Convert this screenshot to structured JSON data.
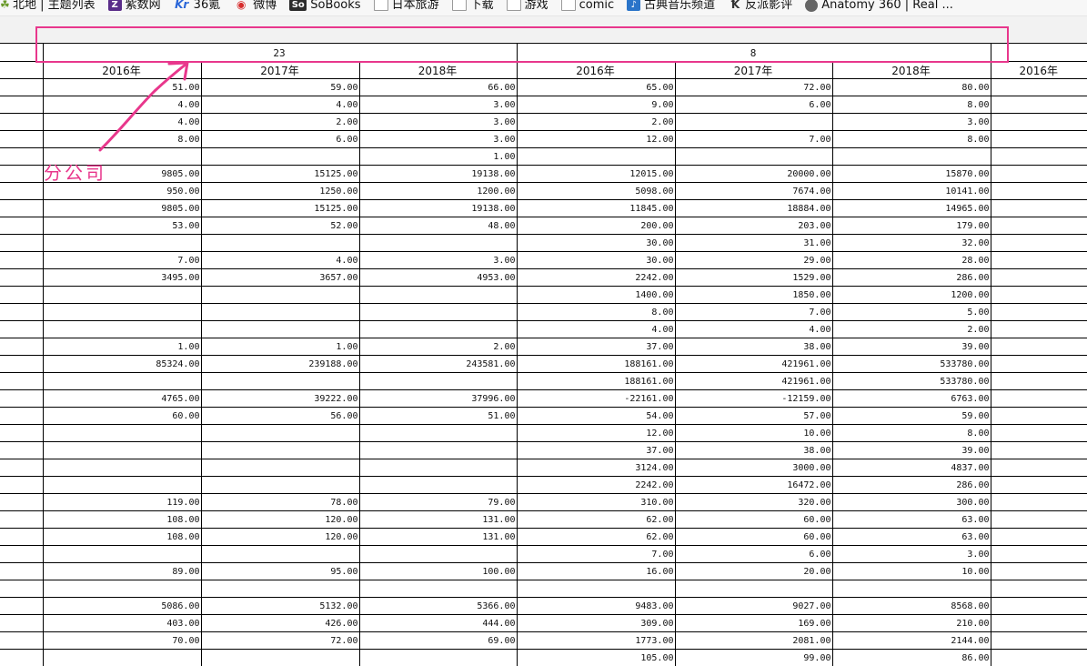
{
  "bookmarks": [
    {
      "label": "北地 | 主题列表",
      "icon": "leaf-icon"
    },
    {
      "label": "紫数网",
      "icon": "z-logo-icon"
    },
    {
      "label": "36氪",
      "icon": "kr-logo-icon"
    },
    {
      "label": "微博",
      "icon": "weibo-icon"
    },
    {
      "label": "SoBooks",
      "icon": "sobooks-icon"
    },
    {
      "label": "日本旅游",
      "icon": "folder-icon"
    },
    {
      "label": "下载",
      "icon": "folder-icon"
    },
    {
      "label": "游戏",
      "icon": "folder-icon"
    },
    {
      "label": "comic",
      "icon": "folder-icon"
    },
    {
      "label": "古典音乐频道",
      "icon": "music-icon"
    },
    {
      "label": "反派影评",
      "icon": "fan-icon"
    },
    {
      "label": "Anatomy 360 | Real ...",
      "icon": "globe-icon"
    }
  ],
  "table": {
    "groups": [
      "23",
      "8"
    ],
    "years": [
      "2016年",
      "2017年",
      "2018年",
      "2016年",
      "2017年",
      "2018年",
      "2016年"
    ],
    "rows": [
      [
        "51.00",
        "59.00",
        "66.00",
        "65.00",
        "72.00",
        "80.00"
      ],
      [
        "4.00",
        "4.00",
        "3.00",
        "9.00",
        "6.00",
        "8.00"
      ],
      [
        "4.00",
        "2.00",
        "3.00",
        "2.00",
        "",
        "3.00"
      ],
      [
        "8.00",
        "6.00",
        "3.00",
        "12.00",
        "7.00",
        "8.00"
      ],
      [
        "",
        "",
        "1.00",
        "",
        "",
        ""
      ],
      [
        "9805.00",
        "15125.00",
        "19138.00",
        "12015.00",
        "20000.00",
        "15870.00"
      ],
      [
        "950.00",
        "1250.00",
        "1200.00",
        "5098.00",
        "7674.00",
        "10141.00"
      ],
      [
        "9805.00",
        "15125.00",
        "19138.00",
        "11845.00",
        "18884.00",
        "14965.00"
      ],
      [
        "53.00",
        "52.00",
        "48.00",
        "200.00",
        "203.00",
        "179.00"
      ],
      [
        "",
        "",
        "",
        "30.00",
        "31.00",
        "32.00"
      ],
      [
        "7.00",
        "4.00",
        "3.00",
        "30.00",
        "29.00",
        "28.00"
      ],
      [
        "3495.00",
        "3657.00",
        "4953.00",
        "2242.00",
        "1529.00",
        "286.00"
      ],
      [
        "",
        "",
        "",
        "1400.00",
        "1850.00",
        "1200.00"
      ],
      [
        "",
        "",
        "",
        "8.00",
        "7.00",
        "5.00"
      ],
      [
        "",
        "",
        "",
        "4.00",
        "4.00",
        "2.00"
      ],
      [
        "1.00",
        "1.00",
        "2.00",
        "37.00",
        "38.00",
        "39.00"
      ],
      [
        "85324.00",
        "239188.00",
        "243581.00",
        "188161.00",
        "421961.00",
        "533780.00"
      ],
      [
        "",
        "",
        "",
        "188161.00",
        "421961.00",
        "533780.00"
      ],
      [
        "4765.00",
        "39222.00",
        "37996.00",
        "-22161.00",
        "-12159.00",
        "6763.00"
      ],
      [
        "60.00",
        "56.00",
        "51.00",
        "54.00",
        "57.00",
        "59.00"
      ],
      [
        "",
        "",
        "",
        "12.00",
        "10.00",
        "8.00"
      ],
      [
        "",
        "",
        "",
        "37.00",
        "38.00",
        "39.00"
      ],
      [
        "",
        "",
        "",
        "3124.00",
        "3000.00",
        "4837.00"
      ],
      [
        "",
        "",
        "",
        "2242.00",
        "16472.00",
        "286.00"
      ],
      [
        "119.00",
        "78.00",
        "79.00",
        "310.00",
        "320.00",
        "300.00"
      ],
      [
        "108.00",
        "120.00",
        "131.00",
        "62.00",
        "60.00",
        "63.00"
      ],
      [
        "108.00",
        "120.00",
        "131.00",
        "62.00",
        "60.00",
        "63.00"
      ],
      [
        "",
        "",
        "",
        "7.00",
        "6.00",
        "3.00"
      ],
      [
        "89.00",
        "95.00",
        "100.00",
        "16.00",
        "20.00",
        "10.00"
      ],
      [
        "",
        "",
        "",
        "",
        "",
        ""
      ],
      [
        "5086.00",
        "5132.00",
        "5366.00",
        "9483.00",
        "9027.00",
        "8568.00"
      ],
      [
        "403.00",
        "426.00",
        "444.00",
        "309.00",
        "169.00",
        "210.00"
      ],
      [
        "70.00",
        "72.00",
        "69.00",
        "1773.00",
        "2081.00",
        "2144.00"
      ],
      [
        "",
        "",
        "",
        "105.00",
        "99.00",
        "86.00"
      ]
    ]
  },
  "annotation": {
    "label": "分公司",
    "color": "#e8378c"
  }
}
